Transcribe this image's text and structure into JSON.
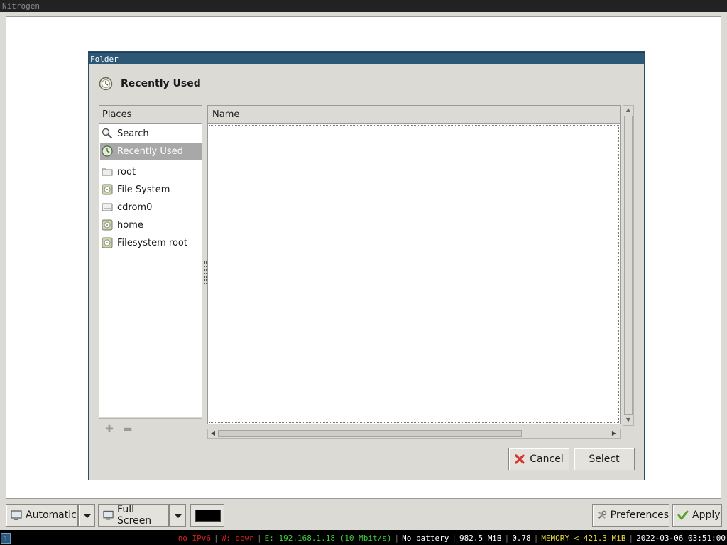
{
  "outer_window": {
    "title": "Nitrogen"
  },
  "dialog": {
    "title": "Folder",
    "header": "Recently Used",
    "places_header": "Places",
    "places": [
      {
        "label": "Search",
        "icon": "search-icon"
      },
      {
        "label": "Recently Used",
        "icon": "recent-icon",
        "selected": true
      },
      {
        "label": "root",
        "icon": "folder-icon"
      },
      {
        "label": "File System",
        "icon": "drive-icon"
      },
      {
        "label": "cdrom0",
        "icon": "cdrom-icon"
      },
      {
        "label": "home",
        "icon": "drive-icon"
      },
      {
        "label": "Filesystem root",
        "icon": "drive-icon"
      }
    ],
    "column_name": "Name",
    "cancel_label": "ancel",
    "cancel_mnemonic": "C",
    "select_label": "Select"
  },
  "toolbar": {
    "mode_label": "Automatic",
    "fill_label": "Full Screen",
    "preferences_label": "Preferences",
    "apply_label": "Apply",
    "bg_color": "#000000"
  },
  "statusbar": {
    "workspace": "1",
    "ipv6": "no IPv6",
    "wireless": "W: down",
    "ethernet": "E: 192.168.1.18 (10 Mbit/s)",
    "battery": "No battery",
    "disk": "982.5 MiB",
    "load": "0.78",
    "memory": "MEMORY < 421.3 MiB",
    "datetime": "2022-03-06 03:51:00"
  }
}
